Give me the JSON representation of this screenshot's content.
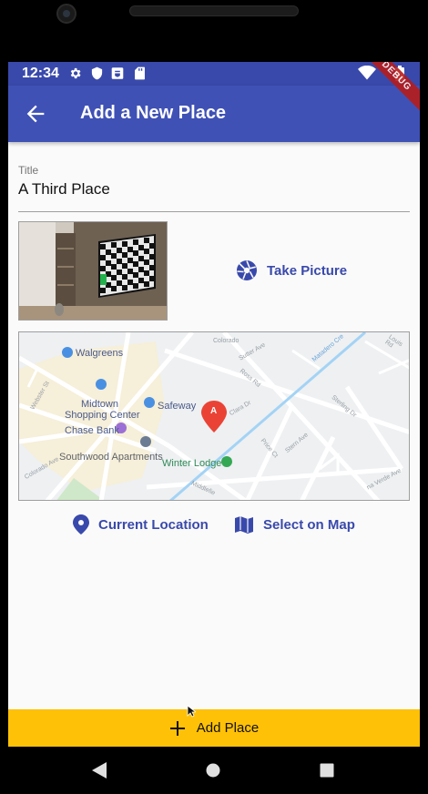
{
  "status_bar": {
    "time": "12:34",
    "icons": [
      "gear-icon",
      "shield-icon",
      "badge-icon",
      "sd-card-icon",
      "wifi-icon",
      "battery-icon"
    ]
  },
  "app_bar": {
    "title": "Add a New Place",
    "back_icon": "arrow-back-icon",
    "debug_banner": "DEBUG"
  },
  "form": {
    "title_label": "Title",
    "title_value": "A Third Place"
  },
  "image_input": {
    "take_picture_label": "Take Picture",
    "icon": "camera-icon"
  },
  "map": {
    "places": {
      "walgreens": "Walgreens",
      "midtown_1": "Midtown",
      "midtown_2": "Shopping Center",
      "safeway": "Safeway",
      "chase_bank": "Chase Bank",
      "southwood": "Southwood Apartments",
      "winter_lodge": "Winter Lodge",
      "marker": "A"
    },
    "streets": {
      "colorado": "Colorado",
      "sutter": "Sutter Ave",
      "ross": "Ross Rd",
      "clara": "Clara Dr",
      "louis": "Louis Rd",
      "sterling": "Sterling Dr",
      "webster": "Webster St",
      "price": "Price Ct",
      "stern": "Stern Ave",
      "colorado_ave": "Colorado Ave",
      "middlefield": "Middlefie",
      "verde": "na Verde Ave",
      "matadero": "Matadero Cre"
    }
  },
  "location_actions": {
    "current_location": "Current Location",
    "select_on_map": "Select on Map"
  },
  "submit": {
    "label": "Add Place",
    "icon": "plus-icon"
  },
  "colors": {
    "primary": "#3f51b5",
    "status_bar": "#3949ab",
    "accent_button": "#ffc107",
    "debug_banner": "#b71c1c"
  }
}
